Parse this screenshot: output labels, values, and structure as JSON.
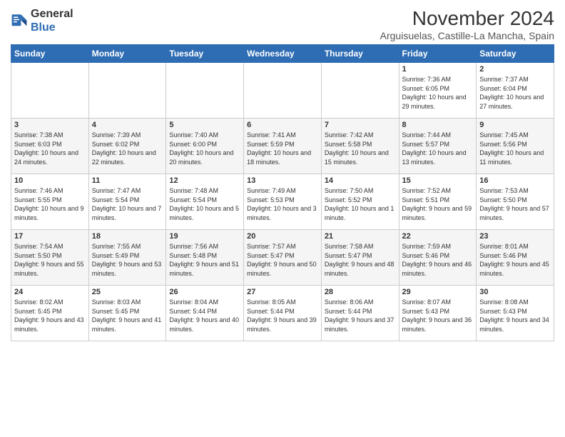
{
  "header": {
    "logo_general": "General",
    "logo_blue": "Blue",
    "month_title": "November 2024",
    "subtitle": "Arguisuelas, Castille-La Mancha, Spain"
  },
  "days_of_week": [
    "Sunday",
    "Monday",
    "Tuesday",
    "Wednesday",
    "Thursday",
    "Friday",
    "Saturday"
  ],
  "weeks": [
    [
      {
        "day": "",
        "info": ""
      },
      {
        "day": "",
        "info": ""
      },
      {
        "day": "",
        "info": ""
      },
      {
        "day": "",
        "info": ""
      },
      {
        "day": "",
        "info": ""
      },
      {
        "day": "1",
        "info": "Sunrise: 7:36 AM\nSunset: 6:05 PM\nDaylight: 10 hours and 29 minutes."
      },
      {
        "day": "2",
        "info": "Sunrise: 7:37 AM\nSunset: 6:04 PM\nDaylight: 10 hours and 27 minutes."
      }
    ],
    [
      {
        "day": "3",
        "info": "Sunrise: 7:38 AM\nSunset: 6:03 PM\nDaylight: 10 hours and 24 minutes."
      },
      {
        "day": "4",
        "info": "Sunrise: 7:39 AM\nSunset: 6:02 PM\nDaylight: 10 hours and 22 minutes."
      },
      {
        "day": "5",
        "info": "Sunrise: 7:40 AM\nSunset: 6:00 PM\nDaylight: 10 hours and 20 minutes."
      },
      {
        "day": "6",
        "info": "Sunrise: 7:41 AM\nSunset: 5:59 PM\nDaylight: 10 hours and 18 minutes."
      },
      {
        "day": "7",
        "info": "Sunrise: 7:42 AM\nSunset: 5:58 PM\nDaylight: 10 hours and 15 minutes."
      },
      {
        "day": "8",
        "info": "Sunrise: 7:44 AM\nSunset: 5:57 PM\nDaylight: 10 hours and 13 minutes."
      },
      {
        "day": "9",
        "info": "Sunrise: 7:45 AM\nSunset: 5:56 PM\nDaylight: 10 hours and 11 minutes."
      }
    ],
    [
      {
        "day": "10",
        "info": "Sunrise: 7:46 AM\nSunset: 5:55 PM\nDaylight: 10 hours and 9 minutes."
      },
      {
        "day": "11",
        "info": "Sunrise: 7:47 AM\nSunset: 5:54 PM\nDaylight: 10 hours and 7 minutes."
      },
      {
        "day": "12",
        "info": "Sunrise: 7:48 AM\nSunset: 5:54 PM\nDaylight: 10 hours and 5 minutes."
      },
      {
        "day": "13",
        "info": "Sunrise: 7:49 AM\nSunset: 5:53 PM\nDaylight: 10 hours and 3 minutes."
      },
      {
        "day": "14",
        "info": "Sunrise: 7:50 AM\nSunset: 5:52 PM\nDaylight: 10 hours and 1 minute."
      },
      {
        "day": "15",
        "info": "Sunrise: 7:52 AM\nSunset: 5:51 PM\nDaylight: 9 hours and 59 minutes."
      },
      {
        "day": "16",
        "info": "Sunrise: 7:53 AM\nSunset: 5:50 PM\nDaylight: 9 hours and 57 minutes."
      }
    ],
    [
      {
        "day": "17",
        "info": "Sunrise: 7:54 AM\nSunset: 5:50 PM\nDaylight: 9 hours and 55 minutes."
      },
      {
        "day": "18",
        "info": "Sunrise: 7:55 AM\nSunset: 5:49 PM\nDaylight: 9 hours and 53 minutes."
      },
      {
        "day": "19",
        "info": "Sunrise: 7:56 AM\nSunset: 5:48 PM\nDaylight: 9 hours and 51 minutes."
      },
      {
        "day": "20",
        "info": "Sunrise: 7:57 AM\nSunset: 5:47 PM\nDaylight: 9 hours and 50 minutes."
      },
      {
        "day": "21",
        "info": "Sunrise: 7:58 AM\nSunset: 5:47 PM\nDaylight: 9 hours and 48 minutes."
      },
      {
        "day": "22",
        "info": "Sunrise: 7:59 AM\nSunset: 5:46 PM\nDaylight: 9 hours and 46 minutes."
      },
      {
        "day": "23",
        "info": "Sunrise: 8:01 AM\nSunset: 5:46 PM\nDaylight: 9 hours and 45 minutes."
      }
    ],
    [
      {
        "day": "24",
        "info": "Sunrise: 8:02 AM\nSunset: 5:45 PM\nDaylight: 9 hours and 43 minutes."
      },
      {
        "day": "25",
        "info": "Sunrise: 8:03 AM\nSunset: 5:45 PM\nDaylight: 9 hours and 41 minutes."
      },
      {
        "day": "26",
        "info": "Sunrise: 8:04 AM\nSunset: 5:44 PM\nDaylight: 9 hours and 40 minutes."
      },
      {
        "day": "27",
        "info": "Sunrise: 8:05 AM\nSunset: 5:44 PM\nDaylight: 9 hours and 39 minutes."
      },
      {
        "day": "28",
        "info": "Sunrise: 8:06 AM\nSunset: 5:44 PM\nDaylight: 9 hours and 37 minutes."
      },
      {
        "day": "29",
        "info": "Sunrise: 8:07 AM\nSunset: 5:43 PM\nDaylight: 9 hours and 36 minutes."
      },
      {
        "day": "30",
        "info": "Sunrise: 8:08 AM\nSunset: 5:43 PM\nDaylight: 9 hours and 34 minutes."
      }
    ]
  ]
}
